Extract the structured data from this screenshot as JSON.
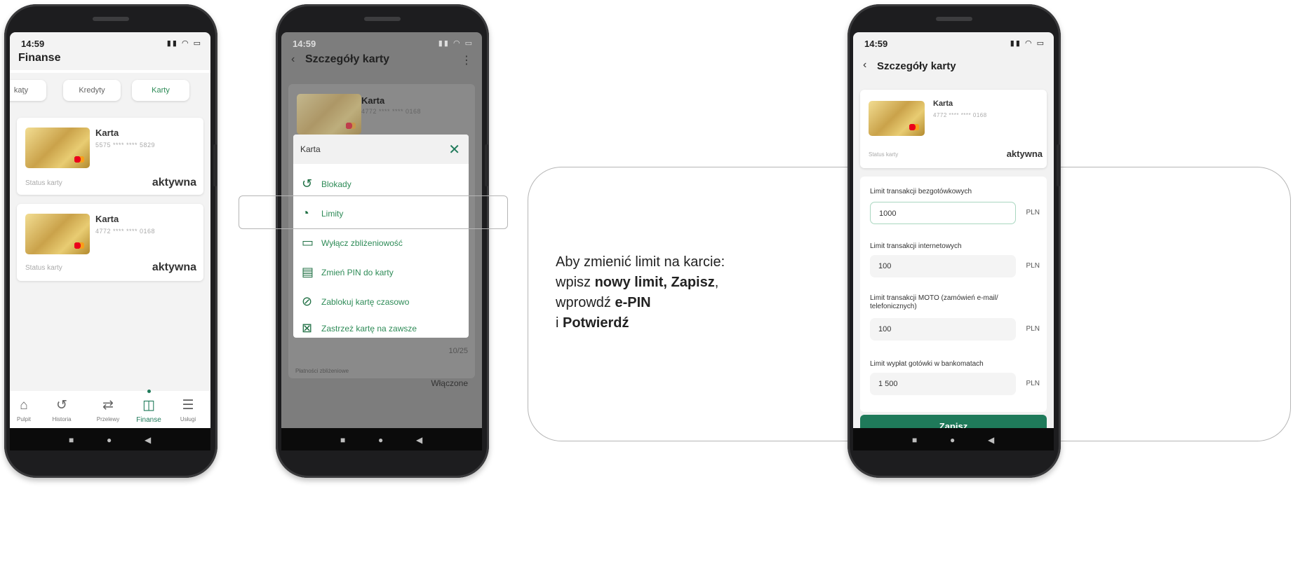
{
  "phone1": {
    "status": {
      "time": "14:59"
    },
    "title": "Finanse",
    "tabs": [
      "kaţy",
      "Kredyty",
      "Karty"
    ],
    "cards": [
      {
        "name": "Karta",
        "number": "5575 **** **** 5829",
        "status_label": "Status karty",
        "status_value": "aktywna"
      },
      {
        "name": "Karta",
        "number": "4772 **** **** 0168",
        "status_label": "Status karty",
        "status_value": "aktywna"
      }
    ],
    "bottom_nav": [
      {
        "label": "Pulpit",
        "icon": "home-icon"
      },
      {
        "label": "Historia",
        "icon": "history-icon"
      },
      {
        "label": "Przelewy",
        "icon": "transfer-icon"
      },
      {
        "label": "Finanse",
        "icon": "wallet-icon"
      },
      {
        "label": "Usługi",
        "icon": "database-icon"
      }
    ]
  },
  "phone2": {
    "status": {
      "time": "14:59"
    },
    "title": "Szczegóły karty",
    "card": {
      "name": "Karta",
      "number": "4772 **** **** 0168"
    },
    "dialog_title": "Karta",
    "menu": [
      {
        "label": "Blokady",
        "icon": "clock-history-icon"
      },
      {
        "label": "Limity",
        "icon": "gauge-icon"
      },
      {
        "label": "Wyłącz zbliżeniowość",
        "icon": "card-contactless-icon"
      },
      {
        "label": "Zmień PIN do karty",
        "icon": "pin-icon"
      },
      {
        "label": "Zablokuj kartę czasowo",
        "icon": "block-icon"
      },
      {
        "label": "Zastrzeż kartę na zawsze",
        "icon": "card-cancel-icon"
      }
    ],
    "bg_expiry": "10/25",
    "bg_contactless_label": "Płatności zbliżeniowe",
    "bg_contactless_value": "Włączone"
  },
  "instruction": {
    "line1": "Aby zmienić limit na karcie:",
    "line2_pre": "wpisz ",
    "line2_bold": "nowy limit, Zapisz",
    "line2_post": ",",
    "line3_pre": "wprowdź ",
    "line3_bold": "e-PIN",
    "line4_pre": "i ",
    "line4_bold": "Potwierdź"
  },
  "phone3": {
    "status": {
      "time": "14:59"
    },
    "title": "Szczegóły karty",
    "card": {
      "name": "Karta",
      "number": "4772 **** **** 0168",
      "status_label": "Status karty",
      "status_value": "aktywna"
    },
    "limits": [
      {
        "label": "Limit transakcji bezgotówkowych",
        "value": "1000",
        "currency": "PLN"
      },
      {
        "label": "Limit transakcji internetowych",
        "value": "100",
        "currency": "PLN"
      },
      {
        "label": "Limit transakcji MOTO (zamówień e-mail/ telefonicznych)",
        "value": "100",
        "currency": "PLN"
      },
      {
        "label": "Limit wypłat gotówki w bankomatach",
        "value": "1 500",
        "currency": "PLN"
      }
    ],
    "save_label": "Zapisz"
  },
  "colors": {
    "accent": "#1f7a5a",
    "text_green": "#2e8b57",
    "frame": "#b5b5b5"
  }
}
